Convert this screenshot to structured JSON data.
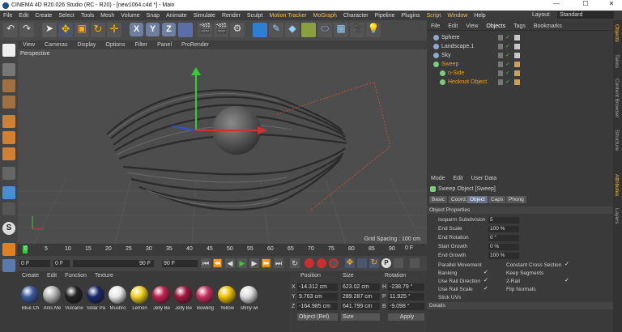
{
  "window": {
    "title": "CINEMA 4D R20.026 Studio (RC - R20) - [new1064.c4d *] - Main",
    "minimize": "—",
    "maximize": "☐",
    "close": "✕"
  },
  "menubar": {
    "items": [
      "File",
      "Edit",
      "Create",
      "Select",
      "Tools",
      "Mesh",
      "Volume",
      "Snap",
      "Animate",
      "Simulate",
      "Render",
      "Sculpt",
      "Motion Tracker",
      "MoGraph",
      "Character",
      "Pipeline",
      "Plugins",
      "Script",
      "Window",
      "Help"
    ],
    "layout_label": "Layout:",
    "layout_value": "Standard"
  },
  "toolbar": {
    "x_label": "X",
    "y_label": "Y",
    "z_label": "Z"
  },
  "viewport": {
    "menu": [
      "View",
      "Cameras",
      "Display",
      "Options",
      "Filter",
      "Panel",
      "ProRender"
    ],
    "camera_label": "Perspective",
    "grid_spacing": "Grid Spacing : 100 cm"
  },
  "timeline": {
    "ticks": [
      "0",
      "5",
      "10",
      "15",
      "20",
      "25",
      "30",
      "35",
      "40",
      "45",
      "50",
      "55",
      "60",
      "65",
      "70",
      "75",
      "80",
      "85",
      "90"
    ],
    "end_marker": "0 F",
    "start_frame": "0 F",
    "current_frame": "0 F",
    "end_frame": "90 F",
    "max_frame": "90 F"
  },
  "materials": {
    "menu": [
      "Create",
      "Edit",
      "Function",
      "Texture"
    ],
    "items": [
      {
        "name": "Blue Ch",
        "color": "#3c5aa0"
      },
      {
        "name": "Anis Me",
        "color": "#b8b8b8"
      },
      {
        "name": "Vulcanix",
        "color": "#222222"
      },
      {
        "name": "Solar Pa",
        "color": "#1a2a6a"
      },
      {
        "name": "Mushro",
        "color": "#e8e8e8"
      },
      {
        "name": "Lemon",
        "color": "#f0d020"
      },
      {
        "name": "Jelly Be",
        "color": "#c02050"
      },
      {
        "name": "Jelly Be",
        "color": "#a01840"
      },
      {
        "name": "Bowling",
        "color": "#c83060"
      },
      {
        "name": "Yellow",
        "color": "#f0c000"
      },
      {
        "name": "shiny wl",
        "color": "#dcdcdc"
      }
    ]
  },
  "coordinates": {
    "headers": [
      "Position",
      "Size",
      "Rotation"
    ],
    "rows": [
      {
        "axis": "X",
        "pos": "-14.312 cm",
        "size": "623.02 cm",
        "rot_axis": "H",
        "rot": "-238.79 °"
      },
      {
        "axis": "Y",
        "pos": "9.763 cm",
        "size": "289.287 cm",
        "rot_axis": "P",
        "rot": "11.925 °"
      },
      {
        "axis": "Z",
        "pos": "-164.985 cm",
        "size": "641.799 cm",
        "rot_axis": "B",
        "rot": "-9.098 °"
      }
    ],
    "mode": "Object (Rel)",
    "size_mode": "Size",
    "apply": "Apply"
  },
  "object_manager": {
    "menu": [
      "File",
      "Edit",
      "View",
      "Objects",
      "Tags",
      "Bookmarks"
    ],
    "objects": [
      {
        "name": "Sphere",
        "color": "#d8d8d8"
      },
      {
        "name": "Landscape.1",
        "color": "#d8d8d8"
      },
      {
        "name": "Sky",
        "color": "#d8d8d8"
      },
      {
        "name": "Sweep",
        "color": "#e8a020"
      },
      {
        "name": "n-Side",
        "color": "#e8a020"
      },
      {
        "name": "Heoknot Object",
        "color": "#e8a020"
      }
    ]
  },
  "attributes": {
    "menu": [
      "Mode",
      "Edit",
      "User Data"
    ],
    "object_title": "Sweep Object [Sweep]",
    "tabs": [
      "Basic",
      "Coord.",
      "Object",
      "Caps",
      "Phong"
    ],
    "section": "Object Properties",
    "fields": [
      {
        "label": "Isoparm Subdivision",
        "value": "5"
      },
      {
        "label": "End Scale",
        "value": "100 %"
      },
      {
        "label": "End Rotation",
        "value": "0 °"
      },
      {
        "label": "Start Growth",
        "value": "0 %"
      },
      {
        "label": "End Growth",
        "value": "100 %"
      }
    ],
    "checks_left": [
      {
        "label": "Parallel Movement",
        "mark": ""
      },
      {
        "label": "Banking",
        "mark": "✓"
      },
      {
        "label": "Use Rail Direction",
        "mark": "✓"
      },
      {
        "label": "Use Rail Scale",
        "mark": "✓"
      },
      {
        "label": "Stick UVs",
        "mark": ""
      }
    ],
    "checks_right": [
      {
        "label": "Constant Cross Section",
        "mark": "✓"
      },
      {
        "label": "Keep Segments",
        "mark": ""
      },
      {
        "label": "2-Rail",
        "mark": "✓"
      },
      {
        "label": "Flip Normals",
        "mark": ""
      }
    ],
    "details": "Details"
  },
  "side_tabs": [
    "Objects",
    "Takes",
    "Content Browser",
    "Structure",
    "Attributes",
    "Layers"
  ]
}
